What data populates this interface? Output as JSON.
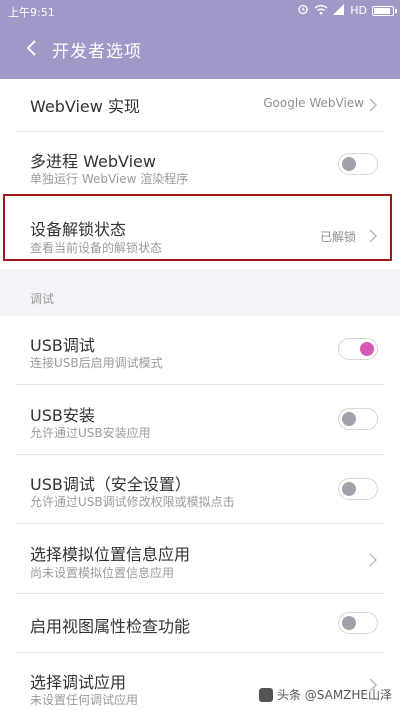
{
  "status_bar": {
    "time": "上午9:51",
    "network": "HD"
  },
  "header": {
    "title": "开发者选项",
    "color": "#a098c6"
  },
  "rows": {
    "webview_impl": {
      "title": "WebView 实现",
      "value": "Google WebView"
    },
    "multiprocess_webview": {
      "title": "多进程 WebView",
      "subtitle": "单独运行 WebView 渲染程序",
      "toggle_on": false
    },
    "unlock_status": {
      "title": "设备解锁状态",
      "subtitle": "查看当前设备的解锁状态",
      "value": "已解锁"
    }
  },
  "debug_section": {
    "label": "调试",
    "usb_debug": {
      "title": "USB调试",
      "subtitle": "连接USB后启用调试模式",
      "toggle_on": true
    },
    "usb_install": {
      "title": "USB安装",
      "subtitle": "允许通过USB安装应用",
      "toggle_on": false
    },
    "usb_debug_secure": {
      "title": "USB调试（安全设置）",
      "subtitle": "允许通过USB调试修改权限或模拟点击",
      "toggle_on": false
    },
    "mock_location": {
      "title": "选择模拟位置信息应用",
      "subtitle": "尚未设置模拟位置信息应用"
    },
    "view_attr_inspect": {
      "title": "启用视图属性检查功能",
      "toggle_on": false
    },
    "debug_app": {
      "title": "选择调试应用",
      "subtitle": "未设置任何调试应用"
    }
  },
  "watermark": "头条 @SAMZHE山泽",
  "colors": {
    "accent": "#d45ab4",
    "highlight_border": "#a01818"
  }
}
